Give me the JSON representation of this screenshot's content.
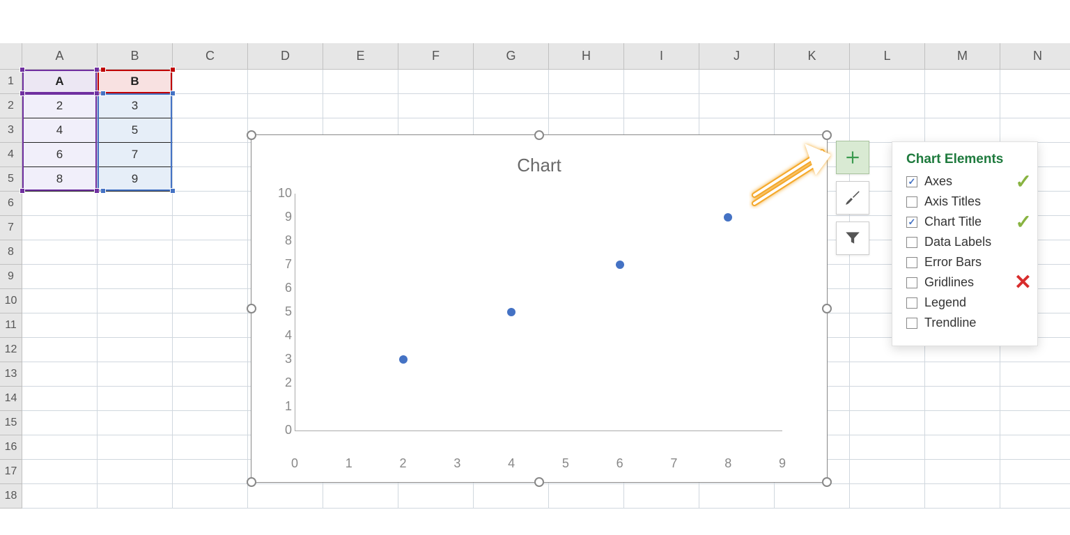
{
  "columns": [
    "A",
    "B",
    "C",
    "D",
    "E",
    "F",
    "G",
    "H",
    "I",
    "J",
    "K",
    "L",
    "M",
    "N"
  ],
  "rows": [
    "1",
    "2",
    "3",
    "4",
    "5",
    "6",
    "7",
    "8",
    "9",
    "10",
    "11",
    "12",
    "13",
    "14",
    "15",
    "16",
    "17",
    "18"
  ],
  "table": {
    "header_a": "A",
    "header_b": "B",
    "data": [
      {
        "a": "2",
        "b": "3"
      },
      {
        "a": "4",
        "b": "5"
      },
      {
        "a": "6",
        "b": "7"
      },
      {
        "a": "8",
        "b": "9"
      }
    ]
  },
  "chart_data": {
    "type": "scatter",
    "title": "Chart",
    "x": [
      2,
      4,
      6,
      8
    ],
    "y": [
      3,
      5,
      7,
      9
    ],
    "xlim": [
      0,
      9
    ],
    "ylim": [
      0,
      10
    ],
    "xticks": [
      0,
      1,
      2,
      3,
      4,
      5,
      6,
      7,
      8,
      9
    ],
    "yticks": [
      0,
      1,
      2,
      3,
      4,
      5,
      6,
      7,
      8,
      9,
      10
    ]
  },
  "side_buttons": {
    "plus_name": "chart-elements-button",
    "brush_name": "chart-styles-button",
    "filter_name": "chart-filters-button"
  },
  "flyout": {
    "title": "Chart Elements",
    "items": [
      {
        "label": "Axes",
        "checked": true,
        "anno": "check"
      },
      {
        "label": "Axis Titles",
        "checked": false,
        "anno": ""
      },
      {
        "label": "Chart Title",
        "checked": true,
        "anno": "check"
      },
      {
        "label": "Data Labels",
        "checked": false,
        "anno": ""
      },
      {
        "label": "Error Bars",
        "checked": false,
        "anno": ""
      },
      {
        "label": "Gridlines",
        "checked": false,
        "anno": "x"
      },
      {
        "label": "Legend",
        "checked": false,
        "anno": ""
      },
      {
        "label": "Trendline",
        "checked": false,
        "anno": ""
      }
    ]
  }
}
